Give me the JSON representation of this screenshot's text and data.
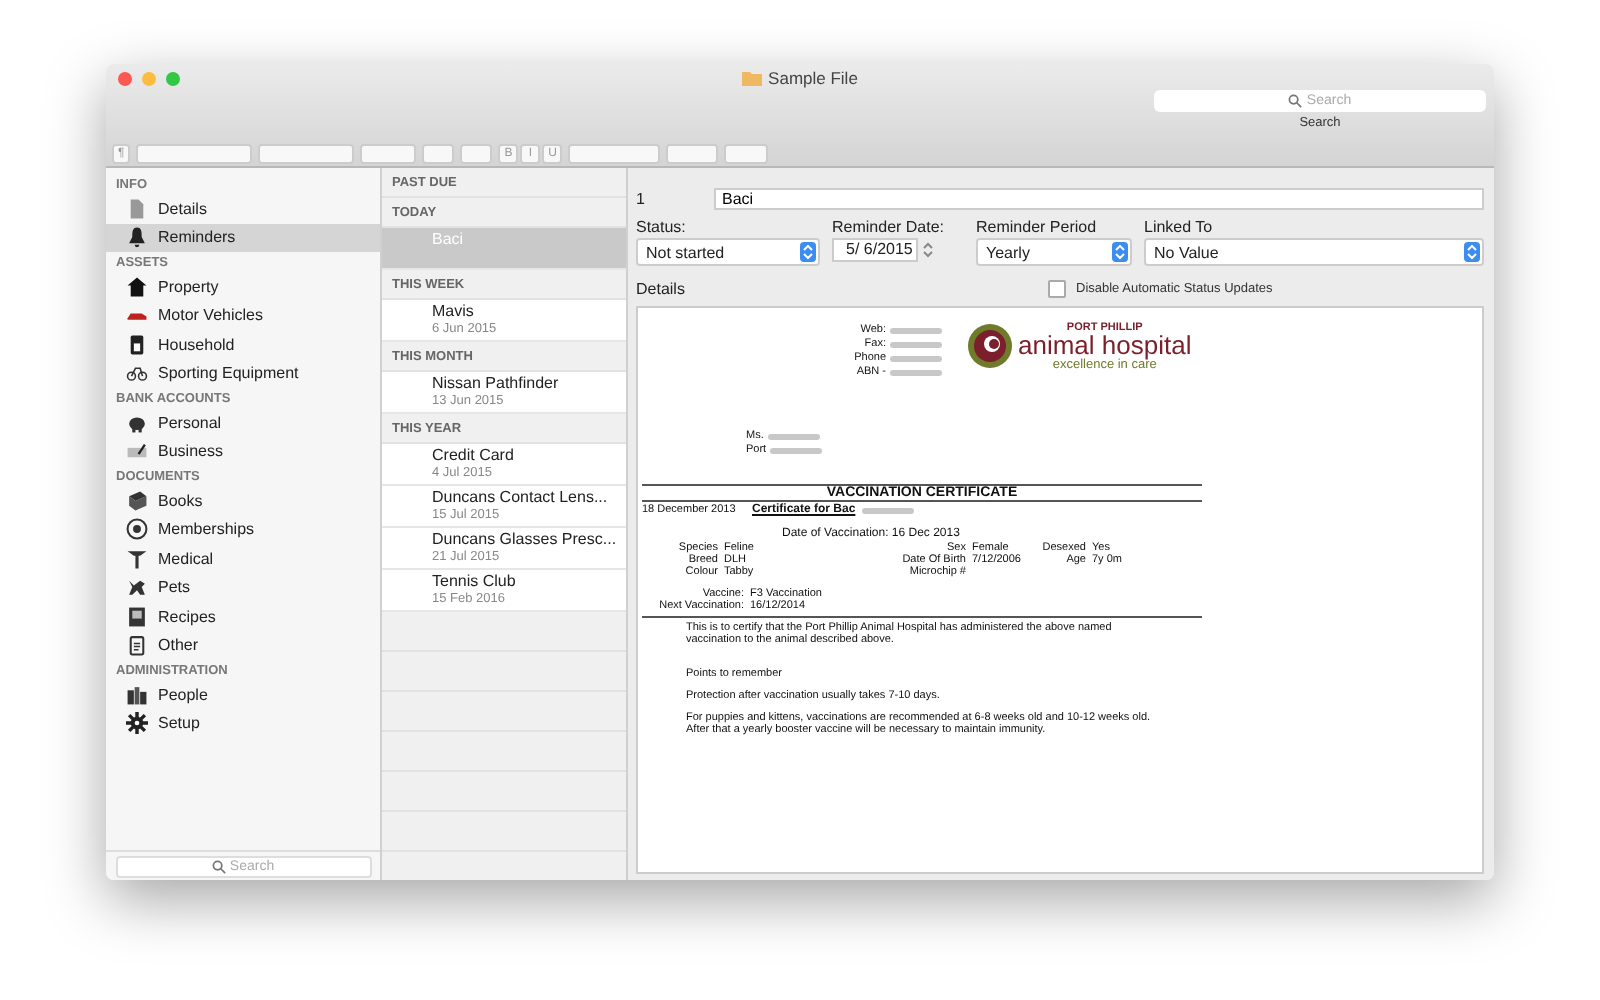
{
  "window": {
    "title": "Sample File"
  },
  "search": {
    "placeholder": "Search",
    "label": "Search"
  },
  "toolbar": {
    "paragraph": "¶",
    "styles": [
      "B",
      "I",
      "U"
    ]
  },
  "sidebar": {
    "sections": [
      {
        "title": "INFO",
        "items": [
          {
            "label": "Details",
            "selected": false
          },
          {
            "label": "Reminders",
            "selected": true
          }
        ]
      },
      {
        "title": "ASSETS",
        "items": [
          {
            "label": "Property",
            "selected": false
          },
          {
            "label": "Motor Vehicles",
            "selected": false
          },
          {
            "label": "Household",
            "selected": false
          },
          {
            "label": "Sporting Equipment",
            "selected": false
          }
        ]
      },
      {
        "title": "BANK ACCOUNTS",
        "items": [
          {
            "label": "Personal",
            "selected": false
          },
          {
            "label": "Business",
            "selected": false
          }
        ]
      },
      {
        "title": "DOCUMENTS",
        "items": [
          {
            "label": "Books",
            "selected": false
          },
          {
            "label": "Memberships",
            "selected": false
          },
          {
            "label": "Medical",
            "selected": false
          },
          {
            "label": "Pets",
            "selected": false
          },
          {
            "label": "Recipes",
            "selected": false
          },
          {
            "label": "Other",
            "selected": false
          }
        ]
      },
      {
        "title": "ADMINISTRATION",
        "items": [
          {
            "label": "People",
            "selected": false
          },
          {
            "label": "Setup",
            "selected": false
          }
        ]
      }
    ],
    "search_placeholder": "Search"
  },
  "reminders": [
    {
      "title": "PAST DUE"
    },
    {
      "title": "TODAY",
      "items": [
        {
          "title": "Baci",
          "selected": true
        }
      ]
    },
    {
      "title": "THIS WEEK",
      "items": [
        {
          "title": "Mavis",
          "date": "6 Jun 2015",
          "selected": false
        }
      ]
    },
    {
      "title": "THIS MONTH",
      "items": [
        {
          "title": "Nissan Pathfinder",
          "date": "13 Jun 2015",
          "selected": false
        }
      ]
    },
    {
      "title": "THIS YEAR",
      "items": [
        {
          "title": "Credit Card",
          "date": "4 Jul 2015",
          "selected": false
        },
        {
          "title": "Duncans Contact Lens...",
          "date": "15 Jul 2015",
          "selected": false
        },
        {
          "title": "Duncans Glasses Presc...",
          "date": "21 Jul 2015",
          "selected": false
        },
        {
          "title": "Tennis Club",
          "date": "15 Feb 2016",
          "selected": false
        }
      ]
    }
  ],
  "detail": {
    "number": "1",
    "name": "Baci",
    "fields": [
      {
        "label": "Status:",
        "value": "Not started",
        "kind": "popup"
      },
      {
        "label": "Reminder Date:",
        "value": "5/ 6/2015",
        "kind": "date"
      },
      {
        "label": "Reminder Period",
        "value": "Yearly",
        "kind": "popup"
      },
      {
        "label": "Linked To",
        "value": "No Value",
        "kind": "popup"
      }
    ],
    "details_label": "Details",
    "disable_updates": {
      "label": "Disable Automatic Status Updates",
      "checked": false
    }
  },
  "document": {
    "contact_labels": [
      "Web:",
      "Fax:",
      "Phone",
      "ABN -"
    ],
    "logo": {
      "top": "PORT PHILLIP",
      "name": "animal hospital",
      "tagline": "excellence in care"
    },
    "address": [
      "Ms.",
      "Port"
    ],
    "heading": "VACCINATION CERTIFICATE",
    "date": "18 December 2013",
    "subject": "Certificate for Bac",
    "vaccination_date": "Date of Vaccination: 16 Dec 2013",
    "pet_columns": [
      [
        {
          "label": "Species",
          "value": "Feline"
        },
        {
          "label": "Breed",
          "value": "DLH"
        },
        {
          "label": "Colour",
          "value": "Tabby"
        }
      ],
      [
        {
          "label": "Sex",
          "value": "Female"
        },
        {
          "label": "Date Of Birth",
          "value": "7/12/2006"
        },
        {
          "label": "Microchip #"
        }
      ],
      [
        {
          "label": "Desexed",
          "value": "Yes"
        },
        {
          "label": "Age",
          "value": "7y 0m"
        }
      ]
    ],
    "vaccine": [
      {
        "label": "Vaccine:",
        "value": "F3 Vaccination"
      },
      {
        "label": "Next Vaccination:",
        "value": "16/12/2014"
      }
    ],
    "paragraphs": [
      "This is to certify that the Port Phillip Animal Hospital has administered the above named vaccination to the animal described above.",
      "Points to remember",
      "Protection after vaccination usually takes 7-10 days.",
      "For puppies and kittens, vaccinations are recommended at 6-8 weeks old and 10-12 weeks old. After that a yearly booster vaccine will be necessary to maintain immunity."
    ]
  }
}
